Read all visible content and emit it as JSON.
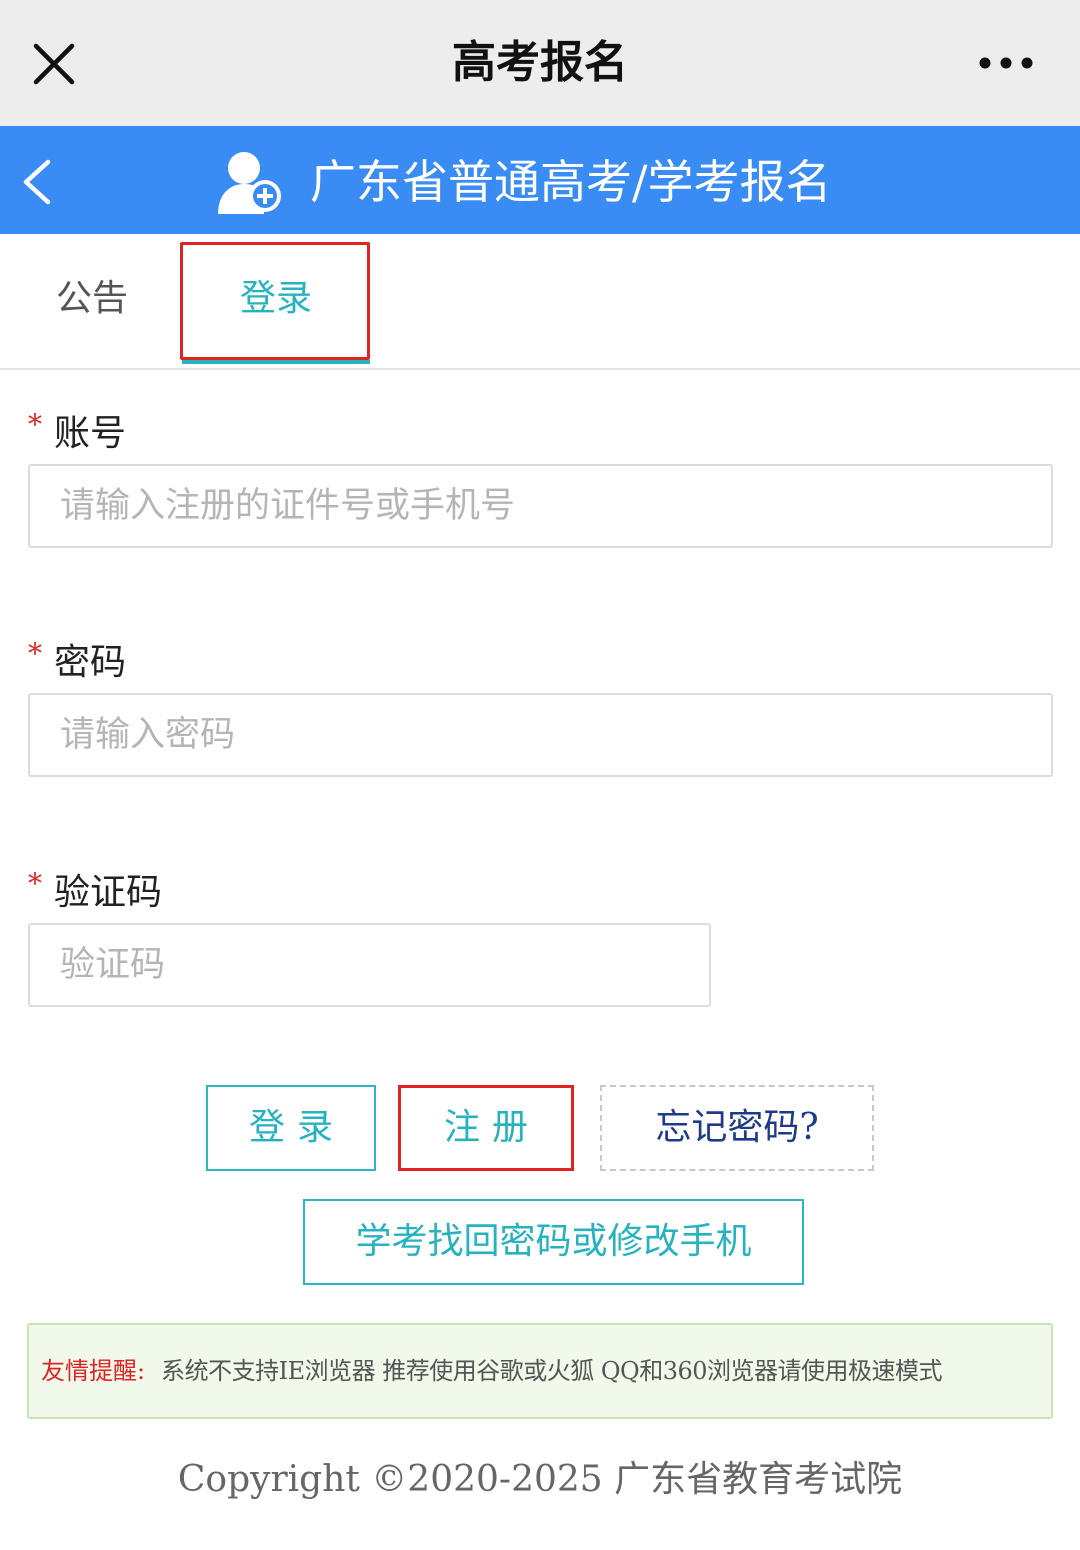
{
  "topbar": {
    "title": "高考报名",
    "close_icon": "close-icon",
    "more_icon": "more-dots-icon"
  },
  "header": {
    "title": "广东省普通高考/学考报名",
    "back_icon": "chevron-left-icon",
    "user_icon": "user-add-icon",
    "background": "#3a8cf5"
  },
  "tabs": [
    {
      "label": "公告",
      "active": false
    },
    {
      "label": "登录",
      "active": true
    }
  ],
  "form": {
    "account": {
      "label": "账号",
      "required_mark": "*",
      "placeholder": "请输入注册的证件号或手机号",
      "value": ""
    },
    "password": {
      "label": "密码",
      "required_mark": "*",
      "placeholder": "请输入密码",
      "value": ""
    },
    "captcha": {
      "label": "验证码",
      "required_mark": "*",
      "placeholder": "验证码",
      "value": ""
    }
  },
  "buttons": {
    "login": "登录",
    "register": "注册",
    "forgot": "忘记密码?",
    "recover": "学考找回密码或修改手机"
  },
  "notice": {
    "label": "友情提醒:",
    "text": "系统不支持IE浏览器 推荐使用谷歌或火狐 QQ和360浏览器请使用极速模式"
  },
  "footer": {
    "copyright": "Copyright ©2020-2025 广东省教育考试院"
  },
  "colors": {
    "accent": "#26b3bf",
    "highlight": "#e02424",
    "header_blue": "#3a8cf5"
  }
}
